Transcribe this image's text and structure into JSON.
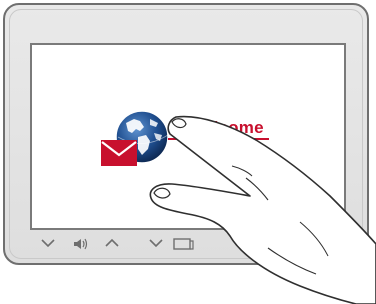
{
  "screen": {
    "welcome_text": "Welcome",
    "accent_color": "#c8102e",
    "globe_color": "#1f4e8f"
  },
  "control_bar": {
    "icons": [
      "chevron-down-icon",
      "speaker-icon",
      "chevron-up-icon",
      "chevron-down-icon",
      "display-icon"
    ]
  }
}
